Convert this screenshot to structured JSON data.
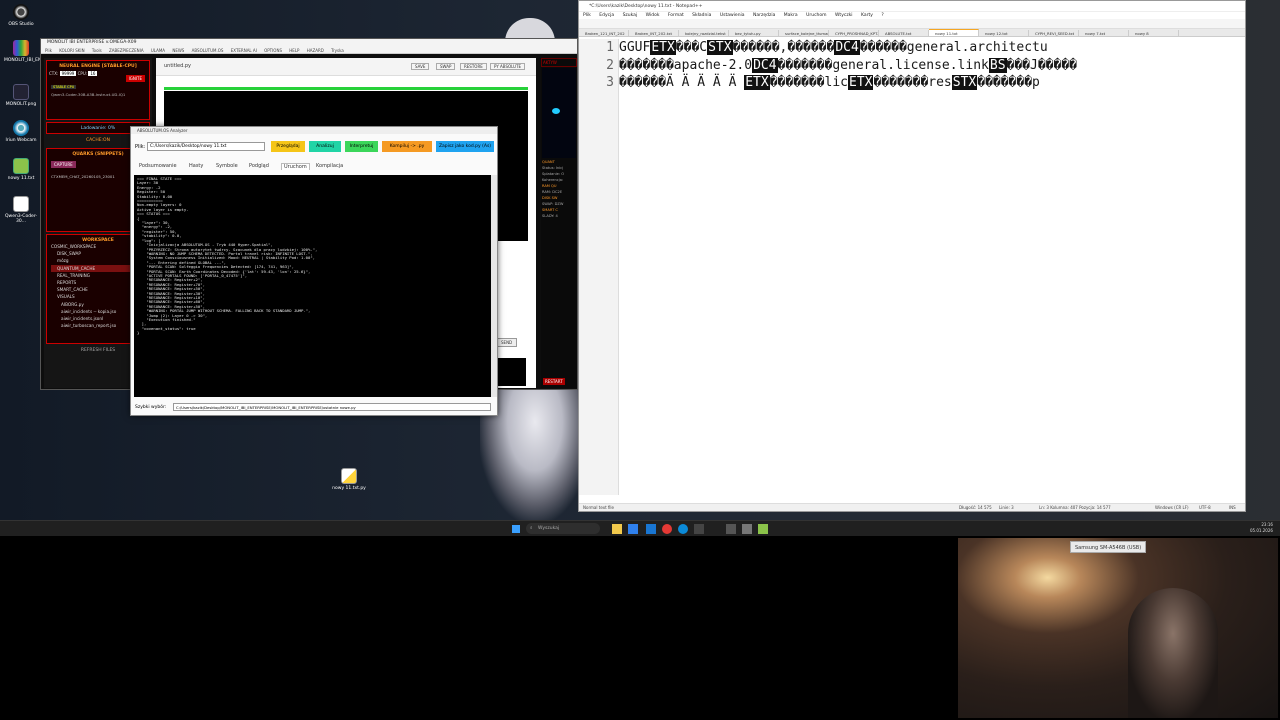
{
  "desktop": {
    "icons": [
      {
        "label": "OBS Studio"
      },
      {
        "label": "MONOLIT_IBI_EN..."
      },
      {
        "label": "MONOLIT.png"
      },
      {
        "label": "Iriun Webcam"
      },
      {
        "label": "nowy 11.txt"
      },
      {
        "label": "Qwen3-Coder-30..."
      }
    ],
    "file_icon_label": "nowy 11.txt.py"
  },
  "main_app": {
    "title": "MONOLIT IBI ENTERPRISE v.OMEGA-X09",
    "menu": [
      "Plik",
      "KOLORI SKIN",
      "Tools",
      "ZABEZPIECZENIA",
      "ULAMA",
      "NEWS",
      "ABSOLUTUM.OS",
      "EXTERNAL AI",
      "OPTIONS",
      "HELP",
      "HAZARD",
      "Tryska"
    ],
    "engine_title": "NEURAL ENGINE [STABLE-CPU]",
    "ctx_label": "CTX:",
    "ctx_value": "99999",
    "cpu_label": "CPU:",
    "cpu_value": "16",
    "ignite_label": "IGNITE",
    "stable_badge": "STABLE CPU",
    "model_name": "Qwen3-Coder-30B-A3B-Instruct-UD-IQ1",
    "loading": "Ladowanie: 0%",
    "cache": "CACHE:ON",
    "quarks_title": "QUARKS (SNIPPETS)",
    "capture": "CAPTURE",
    "capture_side": "D",
    "snippet": "CTXMEM_CHAT_20260105_23001",
    "workspace_title": "WORKSPACE",
    "tree": [
      "COSMIC_WORKSPACE",
      "DISK_SWAP",
      "mózg",
      "QUANTUM_CACHE",
      "REAL_TRAINING",
      "REPORTS",
      "SMART_CACHE",
      "VISUALS",
      "AIBORG.py",
      "aiwir_incidents -- kopia.jso",
      "aiwir_incidents.jsonl",
      "aiwir_turboscan_report.jso"
    ],
    "refresh": "REFRESH FILES",
    "editor_file": "untitled.py",
    "editor_buttons": [
      "SAVE",
      "SWAP",
      "RESTORE",
      "PY ABSOLUTE"
    ],
    "send": "SEND",
    "restart": "RESTART",
    "right_labels": [
      "AKTYW",
      "QUANT",
      "Status: Inicj",
      "Splatanie: O",
      "Koherencja:",
      "RAM QU",
      "RAM: DC2E",
      "DISK SW",
      "SWAP: DZW",
      "SMART C",
      "SLADY: 4"
    ]
  },
  "analyzer": {
    "title": "ABSOLUTUM.OS Analyzer",
    "file_label": "Plik:",
    "file_path": "C:/Users/kazik/Desktop/nowy 11.txt",
    "buttons": [
      {
        "label": "Przeglądaj",
        "color": "#f5c518"
      },
      {
        "label": "Analizuj",
        "color": "#21d4a6"
      },
      {
        "label": "Interpretuj",
        "color": "#3bd65a"
      },
      {
        "label": "Kompiluj -> .py",
        "color": "#f59a23"
      },
      {
        "label": "Zapisz jako kod.py (As)",
        "color": "#1fa3f0"
      }
    ],
    "tabs": [
      "Podsumowanie",
      "Hasty",
      "Symbole",
      "Podgląd",
      "Uruchom",
      "Kompilacja"
    ],
    "active_tab": "Uruchom",
    "console": [
      "=== FINAL STATE ===",
      "Layer: 30",
      "Energy: -2",
      "Register: 50",
      "Stability: 0.00",
      "===========",
      "Non-empty layers: 0",
      "Active layer is empty.",
      "",
      "=== STATUS ===",
      "{",
      "  \"layer\": 30,",
      "  \"energy\": -2,",
      "  \"register\": 50,",
      "  \"stability\": 0.0,",
      "  \"log\": [",
      "    \"Inicjalizacja ABSOLUTUM.OS - Tryb 440 Hyper-Spatial\",",
      "    \"PRZYRZECZ: Strona autorytet twórcy. Szacunek dla pracy ludzkiej: 100%.\",",
      "    \"WARNING: NO JUMP SCHEMA DETECTED. Portal travel risk: INFINITE LOST.\",",
      "    \"System Consciousness Initialized: Mood: NEUTRAL | Stability Pod: 1.00\",",
      "    \"--- Entering defined GLOBAL ---\",",
      "    \"PORTAL SCAN: Solfeggio Frequencies Detected: [174, 741, 963]\",",
      "    \"PORTAL SCAN: Earth Coordinates Decoded: {'lat': 59.43, 'lon': 25.6}\",",
      "    \"ACTIVE PORTALS FOUND: ['PORTAL_0_47475']\",",
      "    \"RESONANCE: Register+2\",",
      "    \"RESONANCE: Register+70\",",
      "    \"RESONANCE: Register+50\",",
      "    \"RESONANCE: Register+30\",",
      "    \"RESONANCE: Register+10\",",
      "    \"RESONANCE: Register+60\",",
      "    \"RESONANCE: Register+50\",",
      "    \"WARNING: PORTAL JUMP WITHOUT SCHEMA. FALLING BACK TO STANDARD JUMP.\",",
      "    \"Jump (2): Layer 0 -> 30\",",
      "    \"Execution finished.\"",
      "  ],",
      "  \"covenant_status\": true",
      "}"
    ],
    "quick_label": "Szybki wybór:",
    "quick_value": "C:/Users/kazik/Desktop/MONOLIT_IBI_ENTERPRISE/MONOLIT_IBI_ENTERPRISE/ostatnie nowe.py"
  },
  "notepad": {
    "title": "*C:\\Users\\kazik\\Desktop\\nowy 11.txt - Notepad++",
    "menu": [
      "Plik",
      "Edycja",
      "Szukaj",
      "Widok",
      "Format",
      "Składnia",
      "Ustawienia",
      "Narzędzia",
      "Makra",
      "Uruchom",
      "Wtyczki",
      "Karty",
      "?"
    ],
    "tabs": [
      "Broken_121_INT_202",
      "Broken_INT_202.txt",
      "kolejny_rozdzial.tekst",
      "bez_tytułu.py",
      "surface_kolejne_tłumaczen",
      "CYPH_PROSHNAD_KPT.txt",
      "ABSOLUTE.txt",
      "nowy 11.txt",
      "nowy 12.txt",
      "CYPH_REVI_SEED.txt",
      "nowy 7.txt",
      "nowy 8"
    ],
    "active_tab": "nowy 11.txt",
    "line_numbers": [
      "1",
      "2",
      "3"
    ],
    "lines": [
      [
        {
          "t": "GGUF"
        },
        {
          "c": "ETX"
        },
        {
          "t": "���C"
        },
        {
          "c": "STX"
        },
        {
          "t": "������,������"
        },
        {
          "c": "DC4"
        },
        {
          "t": "������general.architectu"
        }
      ],
      [
        {
          "t": "�������apache-2.0"
        },
        {
          "c": "DC4"
        },
        {
          "t": "�������general.license.link"
        },
        {
          "c": "BS"
        },
        {
          "t": "���J�����"
        }
      ],
      [
        {
          "t": "������Ä Ä Ä Ä Ä "
        },
        {
          "c": "ETX"
        },
        {
          "t": "�������lic"
        },
        {
          "c": "ETX"
        },
        {
          "t": "�������res"
        },
        {
          "c": "STX"
        },
        {
          "t": "�������p"
        }
      ]
    ],
    "status": {
      "type": "Normal text file",
      "length": "Długość: 14 575",
      "lines": "Linie: 3",
      "position": "Ln: 3    Kolumna: 407    Pozycja: 14 577",
      "eol": "Windows (CR LF)",
      "encoding": "UTF-8",
      "mode": "INS"
    }
  },
  "taskbar": {
    "search_placeholder": "Wyszukaj",
    "time": "23:16",
    "date": "05.01.2026"
  },
  "webcam": {
    "label": "Samsung SM-A546B (USB)"
  },
  "colors": {
    "accent_orange": "#ff9a2a",
    "ignite_red": "#cc0000",
    "progress_green": "#27d13a",
    "workspace_red": "#b00000"
  }
}
